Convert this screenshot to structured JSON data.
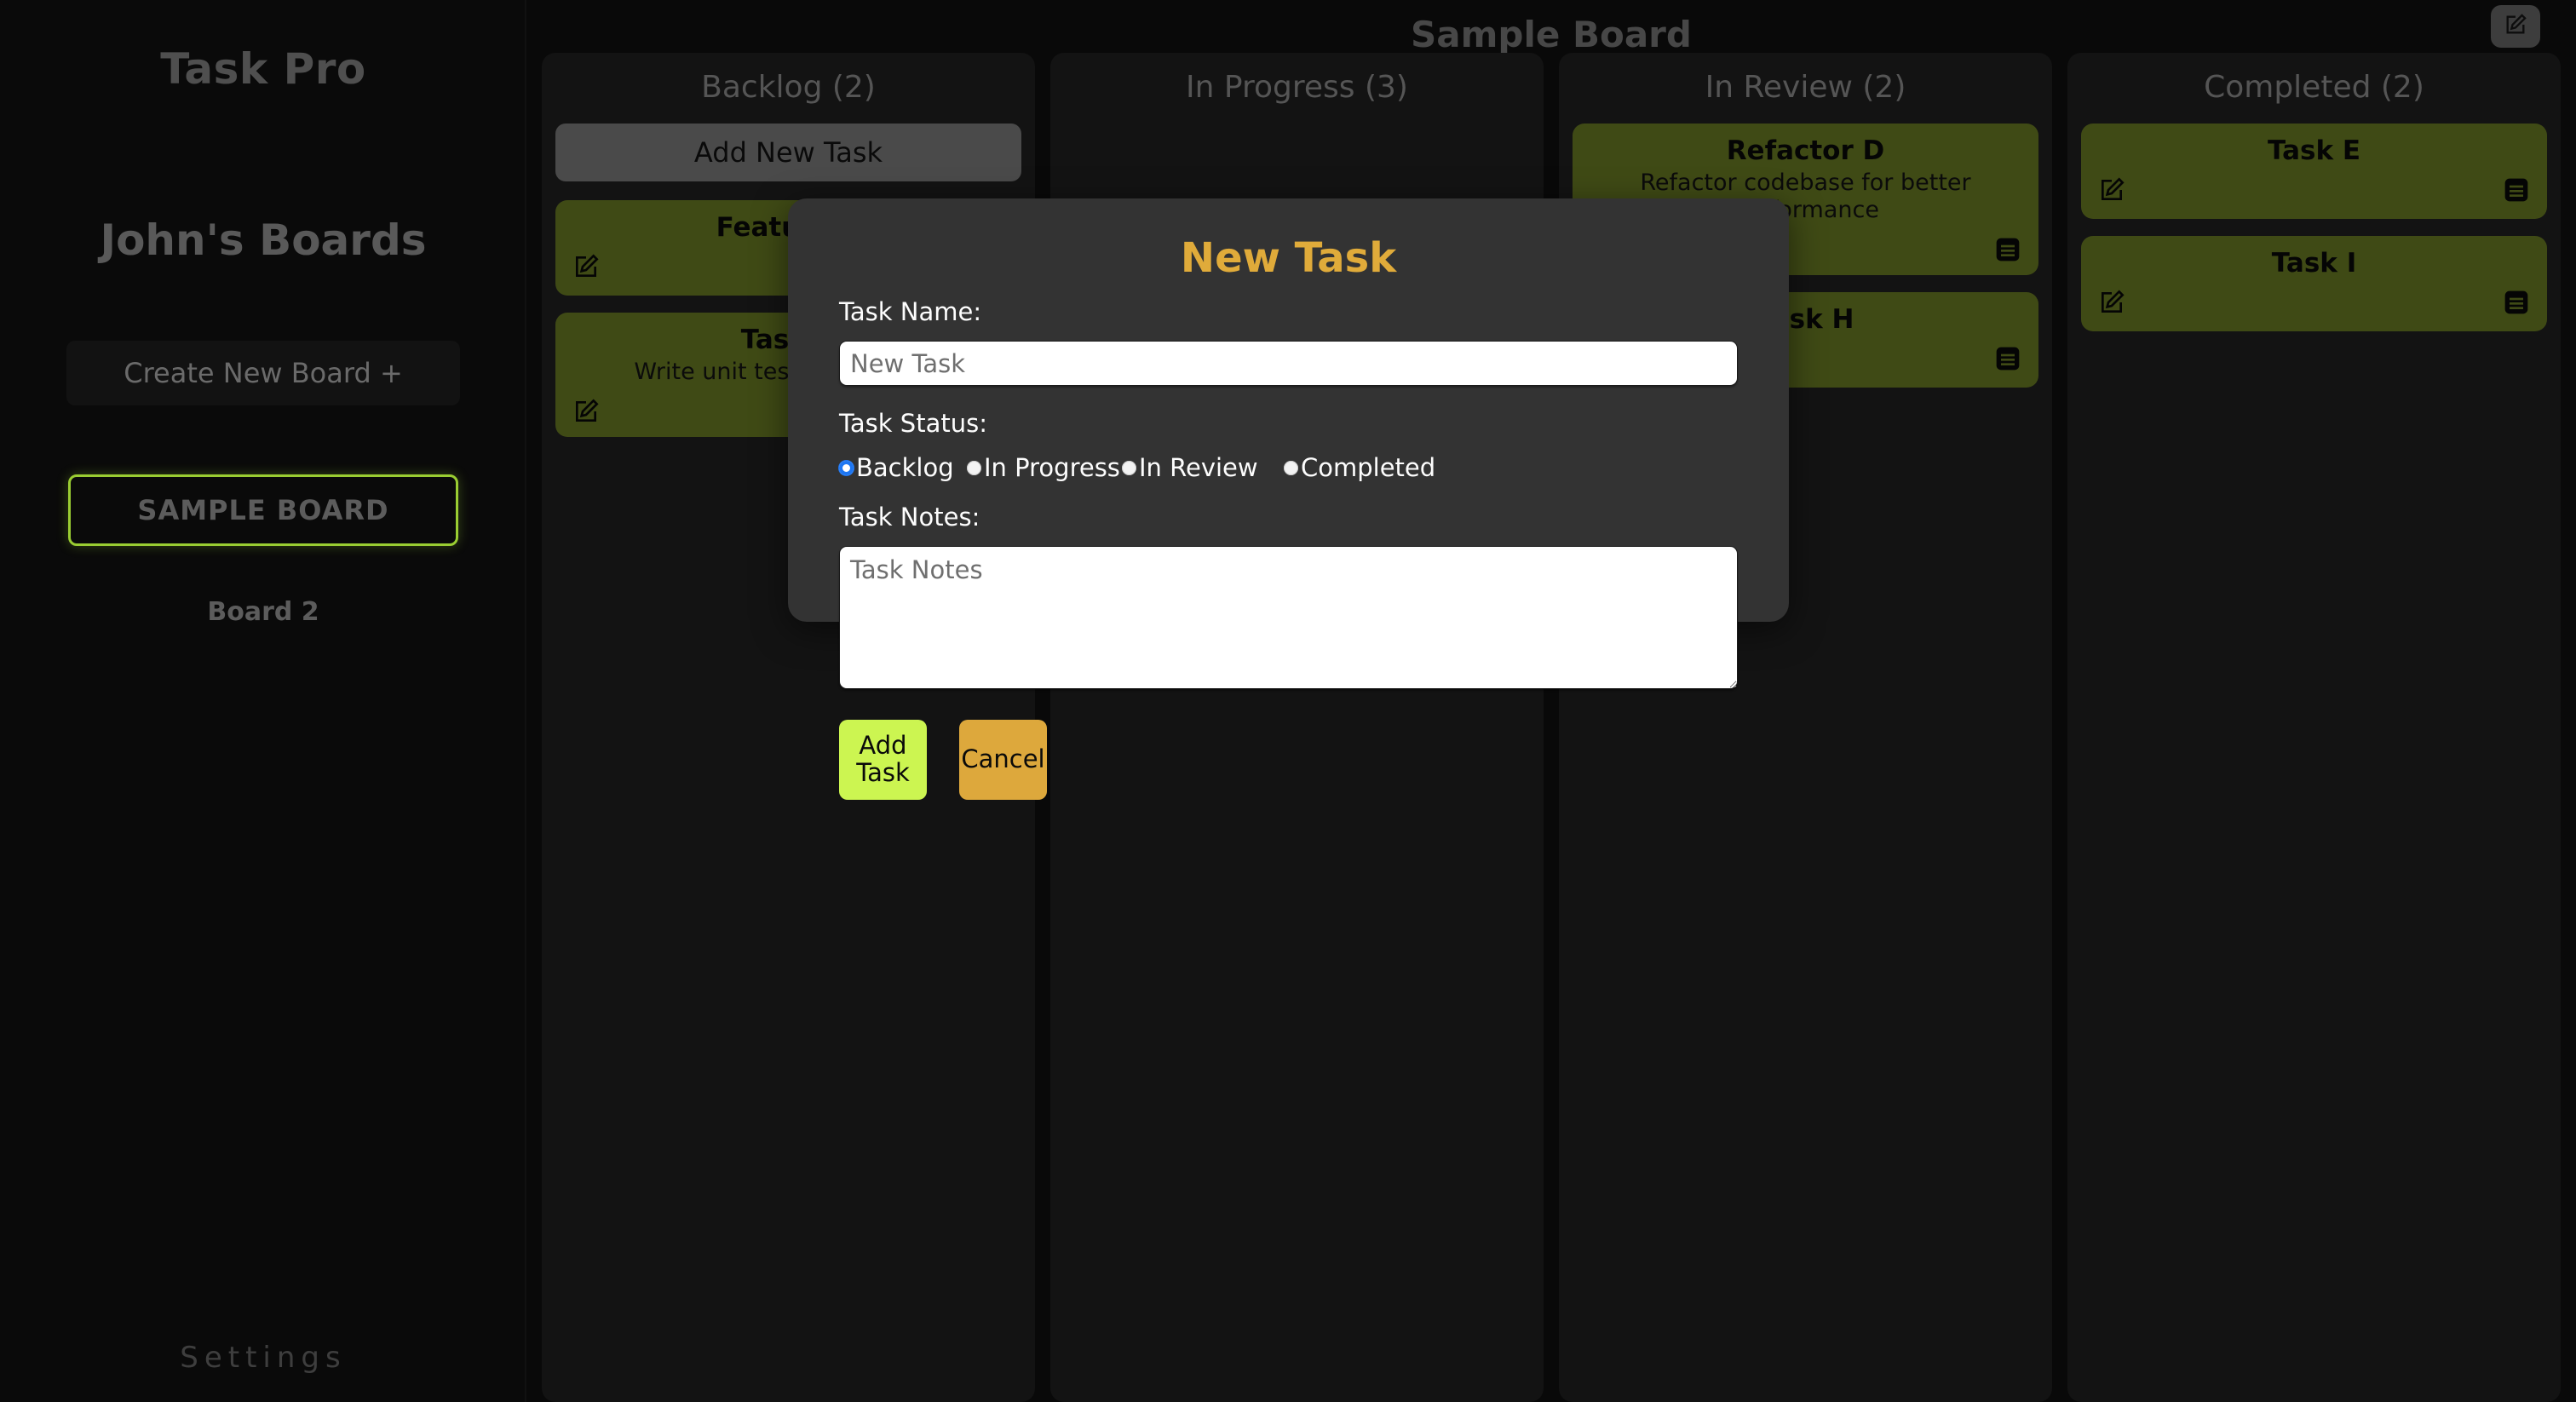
{
  "sidebar": {
    "app_title": "Task Pro",
    "boards_heading": "John's Boards",
    "create_board_label": "Create New Board +",
    "boards": [
      {
        "label": "SAMPLE BOARD",
        "active": true
      },
      {
        "label": "Board 2",
        "active": false
      }
    ],
    "settings_label": "Settings"
  },
  "header": {
    "board_title": "Sample Board",
    "edit_icon": "edit-square-pencil-icon"
  },
  "board": {
    "columns": [
      {
        "header": "Backlog (2)",
        "add_button_label": "Add New Task",
        "show_add_button": true,
        "tasks": [
          {
            "name": "Feature A",
            "notes": "",
            "edit_icon": "edit-square-pencil-icon",
            "notes_icon": "notes-lines-icon",
            "has_notes_icon": false
          },
          {
            "name": "Task B",
            "notes": "Write unit tests for module",
            "edit_icon": "edit-square-pencil-icon",
            "notes_icon": "notes-lines-icon",
            "has_notes_icon": false
          }
        ]
      },
      {
        "header": "In Progress (3)",
        "add_button_label": "Add New Task",
        "show_add_button": false,
        "tasks": []
      },
      {
        "header": "In Review (2)",
        "add_button_label": "Add New Task",
        "show_add_button": false,
        "tasks": [
          {
            "name": "Refactor D",
            "notes": "Refactor codebase for better performance",
            "edit_icon": "edit-square-pencil-icon",
            "notes_icon": "notes-lines-icon",
            "has_notes_icon": true
          },
          {
            "name": "Task H",
            "notes": "",
            "edit_icon": "edit-square-pencil-icon",
            "notes_icon": "notes-lines-icon",
            "has_notes_icon": true
          }
        ]
      },
      {
        "header": "Completed (2)",
        "add_button_label": "Add New Task",
        "show_add_button": false,
        "tasks": [
          {
            "name": "Task E",
            "notes": "",
            "edit_icon": "edit-square-pencil-icon",
            "notes_icon": "notes-lines-icon",
            "has_notes_icon": true
          },
          {
            "name": "Task I",
            "notes": "",
            "edit_icon": "edit-square-pencil-icon",
            "notes_icon": "notes-lines-icon",
            "has_notes_icon": true
          }
        ]
      }
    ]
  },
  "modal": {
    "title": "New Task",
    "task_name_label": "Task Name:",
    "task_name_value": "",
    "task_name_placeholder": "New Task",
    "task_status_label": "Task Status:",
    "status_options": [
      {
        "label": "Backlog",
        "checked": true
      },
      {
        "label": "In Progress",
        "checked": false
      },
      {
        "label": "In Review",
        "checked": false
      },
      {
        "label": "Completed",
        "checked": false
      }
    ],
    "task_notes_label": "Task Notes:",
    "task_notes_value": "",
    "task_notes_placeholder": "Task Notes",
    "add_task_label": "Add Task",
    "cancel_label": "Cancel"
  },
  "colors": {
    "accent_green": "#9acd32",
    "card_green": "#3f4a15",
    "modal_title_gold": "#e0ab3a",
    "add_button_lime": "#ccf551",
    "cancel_orange": "#dda83c",
    "radio_blue": "#1d76f2",
    "page_background": "#090909",
    "modal_background": "#333333"
  }
}
